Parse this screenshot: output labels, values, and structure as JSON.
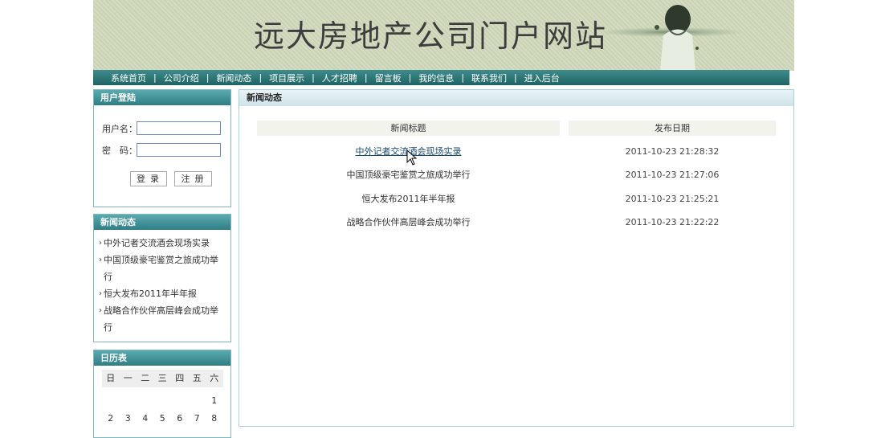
{
  "header": {
    "title": "远大房地产公司门户网站"
  },
  "nav": {
    "items": [
      "系统首页",
      "公司介绍",
      "新闻动态",
      "项目展示",
      "人才招聘",
      "留言板",
      "我的信息",
      "联系我们",
      "进入后台"
    ]
  },
  "login": {
    "heading": "用户登陆",
    "username_label": "用户名：",
    "password_label": "密　码：",
    "login_button": "登录",
    "register_button": "注册"
  },
  "news_box": {
    "heading": "新闻动态",
    "items": [
      "中外记者交流酒会现场实录",
      "中国顶级豪宅鉴赏之旅成功举行",
      "恒大发布2011年半年报",
      "战略合作伙伴高层峰会成功举行"
    ]
  },
  "calendar": {
    "heading": "日历表",
    "weekdays": [
      "日",
      "一",
      "二",
      "三",
      "四",
      "五",
      "六"
    ],
    "row1": [
      "",
      "",
      "",
      "",
      "",
      "",
      "1"
    ],
    "row2": [
      "2",
      "3",
      "4",
      "5",
      "6",
      "7",
      "8"
    ]
  },
  "main": {
    "heading": "新闻动态",
    "columns": [
      "新闻标题",
      "发布日期"
    ],
    "rows": [
      {
        "title": "中外记者交流酒会现场实录",
        "date": "2011-10-23 21:28:32"
      },
      {
        "title": "中国顶级豪宅鉴赏之旅成功举行",
        "date": "2011-10-23 21:27:06"
      },
      {
        "title": "恒大发布2011年半年报",
        "date": "2011-10-23 21:25:21"
      },
      {
        "title": "战略合作伙伴高层峰会成功举行",
        "date": "2011-10-23 21:22:22"
      }
    ]
  },
  "colors": {
    "nav_bg": "#1f6464",
    "box_head": "#2e7e84",
    "banner_bg": "#cdd6b9"
  }
}
